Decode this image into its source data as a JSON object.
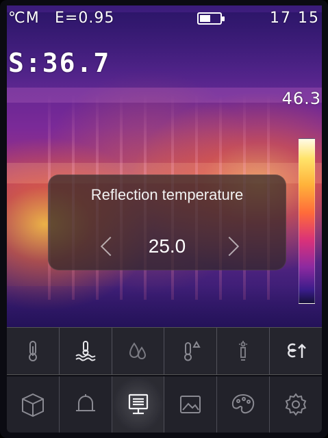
{
  "status_bar": {
    "unit": "℃M",
    "emissivity": "E=0.95",
    "battery_level": 0.55,
    "time": "17 15"
  },
  "readouts": {
    "spot": "S:36.7",
    "max_temp": "46.3"
  },
  "dialog": {
    "title": "Reflection temperature",
    "value": "25.0"
  },
  "toolbar": {
    "selected": "reflection-temperature",
    "items": [
      {
        "icon": "thermometer-icon"
      },
      {
        "icon": "reflection-temperature-icon"
      },
      {
        "icon": "humidity-icon"
      },
      {
        "icon": "temperature-offset-icon"
      },
      {
        "icon": "distance-icon"
      },
      {
        "icon": "emissivity-icon"
      }
    ]
  },
  "menu": {
    "selected": "display",
    "items": [
      {
        "icon": "box-icon"
      },
      {
        "icon": "bell-icon"
      },
      {
        "icon": "display-icon"
      },
      {
        "icon": "image-icon"
      },
      {
        "icon": "palette-icon"
      },
      {
        "icon": "settings-icon"
      }
    ]
  },
  "colors": {
    "palette_hot": "#fffbe8",
    "palette_cold": "#15103a",
    "accent": "#ffffff"
  }
}
